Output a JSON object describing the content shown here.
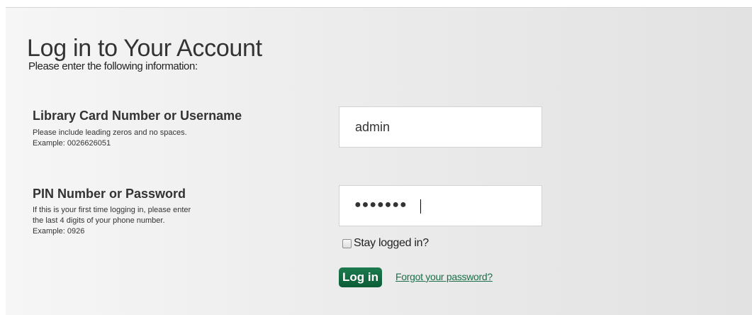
{
  "form": {
    "title": "Log in to Your Account",
    "subtitle": "Please enter the following information:",
    "username": {
      "label": "Library Card Number or Username",
      "hint_line1": "Please include leading zeros and no spaces.",
      "hint_line2": "Example: 0026626051",
      "value": "admin"
    },
    "password": {
      "label": "PIN Number or Password",
      "hint_line1": "If this is your first time logging in, please enter",
      "hint_line2": "the last 4 digits of your phone number.",
      "hint_line3": "Example: 0926",
      "masked_value": "●●●●●●●"
    },
    "stay_logged_in": {
      "label": "Stay logged in?",
      "checked": false
    },
    "login_button": "Log in",
    "forgot_link": "Forgot your password?"
  },
  "colors": {
    "button": "#0f6a40",
    "link": "#1b6f49"
  }
}
